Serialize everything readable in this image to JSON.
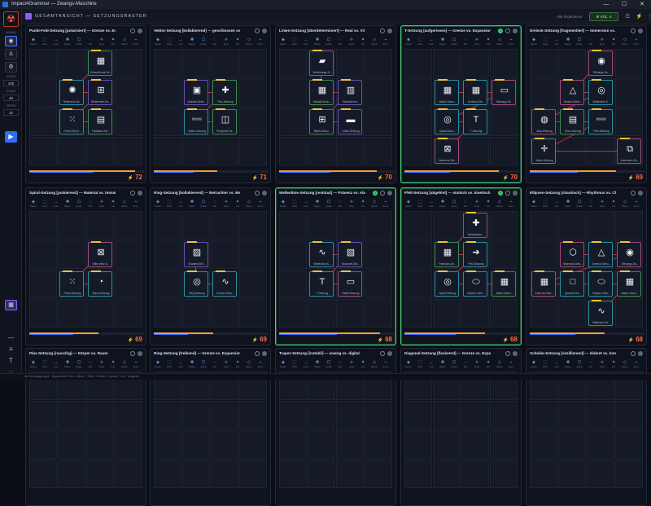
{
  "window": {
    "title": "Impact4Grammar — Zwangs-Maschine"
  },
  "topbar": {
    "title": "GESAMTANSICHT — SETZUNGSRASTER",
    "filter": "Alle Ergebnisse",
    "volume": "VOL. 4"
  },
  "sidebar": {
    "modus": "MODUS",
    "zoom_label": "ZOOM",
    "zoom": "100",
    "rows_label": "ROWS",
    "rows": "40",
    "speed_label": "SPEED",
    "speed": "12"
  },
  "statusbar": {
    "text": "Alt Settungsgruppe · Doppelklick Feld = öffnen · Shift + Ziehen = Ansicht · Alt = Vergleich"
  },
  "toolbar_labels": [
    "Raster",
    "Karte",
    "Linie",
    "Bogen",
    "Quelle",
    "Ziel",
    "Fluss",
    "Info",
    "Ebene",
    "Zoom"
  ],
  "panels": [
    {
      "title": "Punkt-Feld-Setzung [polarisiert] — Grenze vs. Expansion",
      "score": "72",
      "p1": 0.92,
      "p2": 0.55,
      "hl": false,
      "badge": "",
      "nodes": [
        {
          "label": "Schweißnaht-Se...",
          "sym": "▦",
          "cls": "ic-green",
          "r": 0,
          "c": 2
        },
        {
          "label": "Reflexions-Se...",
          "sym": "✺",
          "cls": "ic-cyan",
          "r": 1,
          "c": 1
        },
        {
          "label": "Wellformen-Se...",
          "sym": "⊞",
          "cls": "ic-purple",
          "r": 1,
          "c": 2
        },
        {
          "label": "Punkt-Feld-S...",
          "sym": "⁙",
          "cls": "ic-cyan",
          "r": 2,
          "c": 1
        },
        {
          "label": "Parallaxe-Set...",
          "sym": "▤",
          "cls": "ic-green",
          "r": 2,
          "c": 2
        }
      ]
    },
    {
      "title": "Vektor-Setzung [kollabierend] — geschlossen vs. offen",
      "score": "71",
      "p1": 0.55,
      "p2": 0.35,
      "hl": false,
      "badge": "",
      "nodes": [
        {
          "label": "Quadrat-Setzu...",
          "sym": "▣",
          "cls": "ic-purple",
          "r": 1,
          "c": 1
        },
        {
          "label": "Plus-Setzung",
          "sym": "✚",
          "cls": "ic-green",
          "r": 1,
          "c": 2
        },
        {
          "label": "Vektor-Setzung",
          "sym": "➖",
          "cls": "ic-cyan",
          "r": 2,
          "c": 1
        },
        {
          "label": "Peripherie-Se...",
          "sym": "◫",
          "cls": "ic-green",
          "r": 2,
          "c": 2
        }
      ]
    },
    {
      "title": "Linien-Setzung [überdeterminiert] — Real vs. Virtuell",
      "score": "70",
      "p1": 0.85,
      "p2": 0.45,
      "hl": false,
      "badge": "",
      "nodes": [
        {
          "label": "Schichtungs-S...",
          "sym": "▰",
          "cls": "ic-pink",
          "r": 0,
          "c": 1
        },
        {
          "label": "Mosaik-Setzu...",
          "sym": "▦",
          "cls": "ic-green",
          "r": 1,
          "c": 1
        },
        {
          "label": "Strichelierun...",
          "sym": "▥",
          "cls": "ic-purple",
          "r": 1,
          "c": 2
        },
        {
          "label": "Matrix-Setzu...",
          "sym": "⊞",
          "cls": "ic-green",
          "r": 2,
          "c": 1
        },
        {
          "label": "Linien-Setzung",
          "sym": "▬",
          "cls": "ic-purple",
          "r": 2,
          "c": 2
        }
      ]
    },
    {
      "title": "T-Setzung [aufgerissen] — Grenze vs. Expansion",
      "score": "70",
      "p1": 0.82,
      "p2": 0.4,
      "hl": true,
      "badge": "3",
      "nodes": [
        {
          "label": "Matrix-Setzu...",
          "sym": "▦",
          "cls": "ic-cyan",
          "r": 1,
          "c": 1
        },
        {
          "label": "Kontrast-Set...",
          "sym": "▦",
          "cls": "ic-cyan",
          "r": 1,
          "c": 2
        },
        {
          "label": "Überlapp-Se...",
          "sym": "▭",
          "cls": "ic-pink",
          "r": 1,
          "c": 3
        },
        {
          "label": "Spiral-Setzu...",
          "sym": "◎",
          "cls": "ic-cyan",
          "r": 2,
          "c": 1
        },
        {
          "label": "T-Setzung",
          "sym": "T",
          "cls": "ic-cyan",
          "r": 2,
          "c": 2
        },
        {
          "label": "Netzwerk-Set...",
          "sym": "⊠",
          "cls": "ic-pink",
          "r": 3,
          "c": 1
        }
      ]
    },
    {
      "title": "Dreieck-Setzung [fragmentiert] — Immersion vs. Distanz",
      "score": "69",
      "p1": 0.75,
      "p2": 0.42,
      "hl": false,
      "badge": "",
      "nodes": [
        {
          "label": "Öffnungs-Se...",
          "sym": "◉",
          "cls": "ic-pink",
          "r": 0,
          "c": 2
        },
        {
          "label": "Dreieck-Setzu...",
          "sym": "△",
          "cls": "ic-pink",
          "r": 1,
          "c": 1
        },
        {
          "label": "Wellenlinie-S...",
          "sym": "◎",
          "cls": "ic-cyan",
          "r": 1,
          "c": 2
        },
        {
          "label": "Auto-Setzung",
          "sym": "◍",
          "cls": "ic-pink",
          "r": 2,
          "c": 0
        },
        {
          "label": "Fluss-Setzung",
          "sym": "▤",
          "cls": "ic-green",
          "r": 2,
          "c": 1
        },
        {
          "label": "Pfeil-Setzung",
          "sym": "➖",
          "cls": "ic-cyan",
          "r": 2,
          "c": 2
        },
        {
          "label": "Anker-Setzung",
          "sym": "✛",
          "cls": "ic-cyan",
          "r": 3,
          "c": 0
        },
        {
          "label": "Ausbruchs-Se...",
          "sym": "⧉",
          "cls": "ic-pink",
          "r": 3,
          "c": 3
        }
      ]
    },
    {
      "title": "Spiral-Setzung [pulsierend] — Material vs. Immaterial",
      "score": "69",
      "p1": 0.6,
      "p2": 0.38,
      "hl": false,
      "badge": "",
      "nodes": [
        {
          "label": "Gitter-Netz-S...",
          "sym": "⊠",
          "cls": "ic-pink",
          "r": 1,
          "c": 2
        },
        {
          "label": "Punkt-Setzung",
          "sym": "⁙",
          "cls": "ic-cyan",
          "r": 2,
          "c": 1
        },
        {
          "label": "Spiral-Setzung",
          "sym": "◔",
          "cls": "ic-cyan",
          "r": 2,
          "c": 2
        }
      ]
    },
    {
      "title": "Ring-Setzung [kollabierend] — Betrachter vs. Werk",
      "score": "69",
      "p1": 0.52,
      "p2": 0.3,
      "hl": false,
      "badge": "",
      "nodes": [
        {
          "label": "Gradient-Set...",
          "sym": "▨",
          "cls": "ic-purple",
          "r": 1,
          "c": 1
        },
        {
          "label": "Ring-Setzung",
          "sym": "◎",
          "cls": "ic-cyan",
          "r": 2,
          "c": 1
        },
        {
          "label": "Kurven-Setzu...",
          "sym": "∿",
          "cls": "ic-cyan",
          "r": 2,
          "c": 2
        }
      ]
    },
    {
      "title": "Wellenlinie-Setzung [residual] — Präsenz vs. Absenz",
      "score": "68",
      "p1": 0.88,
      "p2": 0.5,
      "hl": true,
      "badge": "1",
      "nodes": [
        {
          "label": "Wellenlinie-S...",
          "sym": "∿",
          "cls": "ic-cyan",
          "r": 1,
          "c": 1
        },
        {
          "label": "Bruchzeit-Set...",
          "sym": "▧",
          "cls": "ic-purple",
          "r": 1,
          "c": 2
        },
        {
          "label": "T-Setzung",
          "sym": "T",
          "cls": "ic-cyan",
          "r": 2,
          "c": 1
        },
        {
          "label": "Relief-Setzung",
          "sym": "▭",
          "cls": "ic-pink",
          "r": 2,
          "c": 2
        }
      ]
    },
    {
      "title": "Pfeil-Setzung [abgelöst] — statisch vs. kinetisch",
      "score": "68",
      "p1": 0.7,
      "p2": 0.45,
      "hl": true,
      "badge": "4",
      "nodes": [
        {
          "label": "Vertikalachs-...",
          "sym": "✚",
          "cls": "ic-pink",
          "r": 0,
          "c": 2
        },
        {
          "label": "Partitions-Se...",
          "sym": "▦",
          "cls": "ic-green",
          "r": 1,
          "c": 1
        },
        {
          "label": "Pfeil-Setzung",
          "sym": "➔",
          "cls": "ic-cyan",
          "r": 1,
          "c": 2
        },
        {
          "label": "Spiral-Setzung",
          "sym": "◎",
          "cls": "ic-cyan",
          "r": 2,
          "c": 1
        },
        {
          "label": "Ellipsen-Setz...",
          "sym": "⬭",
          "cls": "ic-cyan",
          "r": 2,
          "c": 2
        },
        {
          "label": "Matrix-Setzu...",
          "sym": "▦",
          "cls": "ic-green",
          "r": 2,
          "c": 3
        }
      ]
    },
    {
      "title": "Ellipsen-Setzung [chaotisch] — Rhythmus vs. Chaos",
      "score": "68",
      "p1": 0.65,
      "p2": 0.4,
      "hl": false,
      "badge": "",
      "nodes": [
        {
          "label": "Sechseck-Setz...",
          "sym": "⬡",
          "cls": "ic-pink",
          "r": 1,
          "c": 1
        },
        {
          "label": "Dreieck-Setzu...",
          "sym": "△",
          "cls": "ic-cyan",
          "r": 1,
          "c": 2
        },
        {
          "label": "Öffnungs-Se...",
          "sym": "◉",
          "cls": "ic-pink",
          "r": 1,
          "c": 3
        },
        {
          "label": "Kreismer-Setz...",
          "sym": "▦",
          "cls": "ic-pink",
          "r": 2,
          "c": 0
        },
        {
          "label": "Quadrat-Set...",
          "sym": "□",
          "cls": "ic-cyan",
          "r": 2,
          "c": 1
        },
        {
          "label": "Ellipsen-Setz...",
          "sym": "⬭",
          "cls": "ic-cyan",
          "r": 2,
          "c": 2
        },
        {
          "label": "Matrix-Setzu...",
          "sym": "▦",
          "cls": "ic-green",
          "r": 2,
          "c": 3
        },
        {
          "label": "Wellenkor-Se...",
          "sym": "∿",
          "cls": "ic-cyan",
          "r": 3,
          "c": 2
        }
      ]
    },
    {
      "title": "Plus-Setzung [rauschig] — Körper vs. Raum",
      "score": "",
      "p1": 0,
      "p2": 0,
      "hl": false,
      "badge": "",
      "nodes": []
    },
    {
      "title": "Ring-Setzung [treibend] — Grenze vs. Expansion",
      "score": "",
      "p1": 0,
      "p2": 0,
      "hl": false,
      "badge": "",
      "nodes": []
    },
    {
      "title": "Trapez-Setzung [instabil] — analog vs. digital",
      "score": "",
      "p1": 0,
      "p2": 0,
      "hl": false,
      "badge": "",
      "nodes": []
    },
    {
      "title": "Diagonal-Setzung [flackernd] — Grenze vs. Expansion",
      "score": "",
      "p1": 0,
      "p2": 0,
      "hl": false,
      "badge": "",
      "nodes": []
    },
    {
      "title": "Scheibe-Setzung [oszillierend] — diskret vs. kontinuierlich",
      "score": "",
      "p1": 0,
      "p2": 0,
      "hl": false,
      "badge": "",
      "nodes": []
    }
  ]
}
